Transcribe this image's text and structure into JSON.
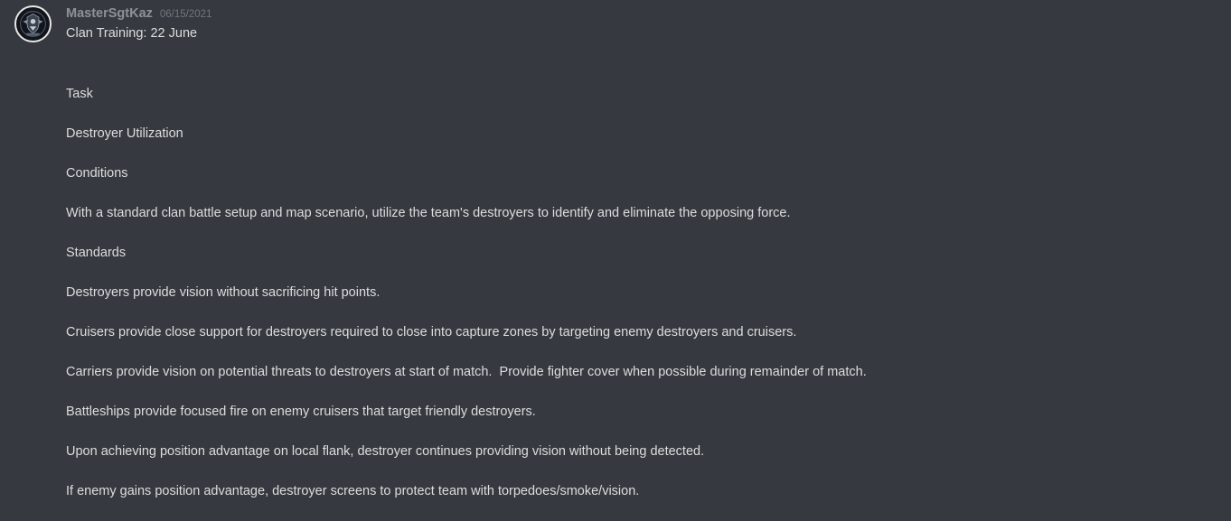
{
  "message": {
    "avatar_icon": "clan-emblem-icon",
    "username": "MasterSgtKaz",
    "timestamp": "06/15/2021",
    "title": "Clan Training: 22 June",
    "lines": [
      "Task",
      "Destroyer Utilization",
      "Conditions",
      "With a standard clan battle setup and map scenario, utilize the team's destroyers to identify and eliminate the opposing force.",
      "Standards",
      "Destroyers provide vision without sacrificing hit points.",
      "Cruisers provide close support for destroyers required to close into capture zones by targeting enemy destroyers and cruisers.",
      "Carriers provide vision on potential threats to destroyers at start of match.  Provide fighter cover when possible during remainder of match.",
      "Battleships provide focused fire on enemy cruisers that target friendly destroyers.",
      "Upon achieving position advantage on local flank, destroyer continues providing vision without being detected.",
      "If enemy gains position advantage, destroyer screens to protect team with torpedoes/smoke/vision."
    ]
  },
  "colors": {
    "background": "#36393f",
    "text": "#dcddde",
    "username": "#8e9297",
    "timestamp": "#72767d"
  }
}
